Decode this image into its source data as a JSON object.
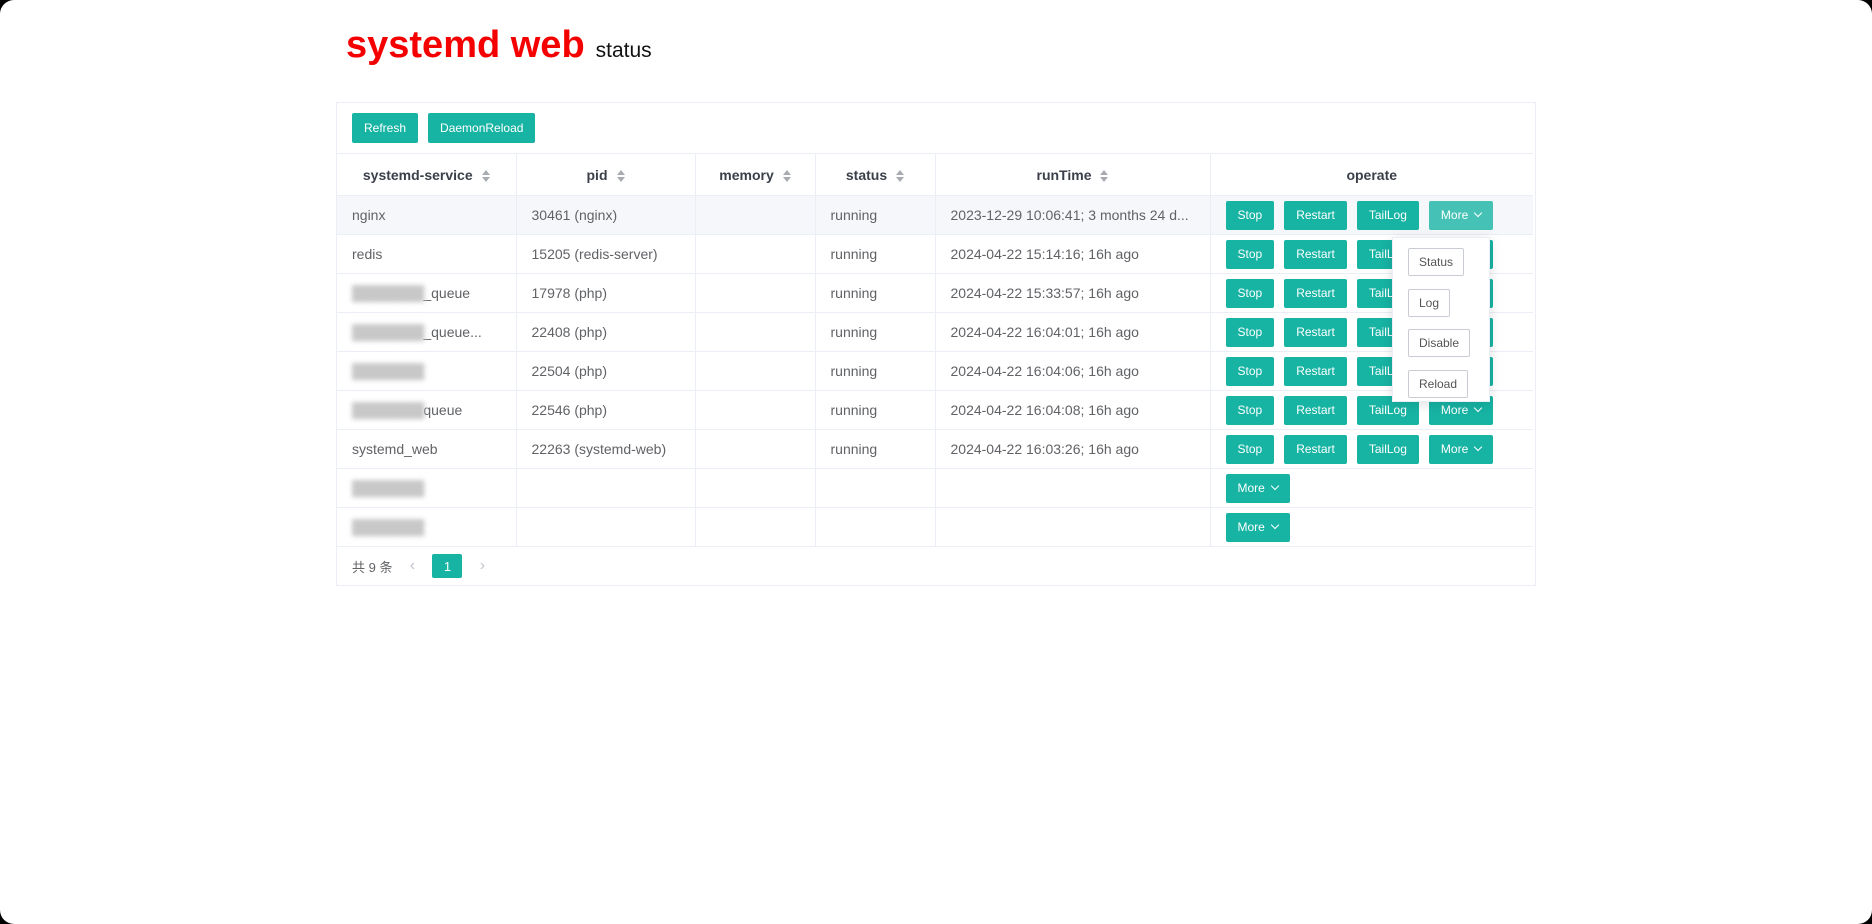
{
  "header": {
    "title": "systemd web",
    "subtitle": "status"
  },
  "toolbar": {
    "refresh": "Refresh",
    "daemon_reload": "DaemonReload"
  },
  "columns": [
    "systemd-service",
    "pid",
    "memory",
    "status",
    "runTime",
    "operate"
  ],
  "actions": {
    "stop": "Stop",
    "restart": "Restart",
    "taillog": "TailLog",
    "more": "More"
  },
  "rows": [
    {
      "service": "nginx",
      "pid": "30461 (nginx)",
      "memory": "",
      "status": "running",
      "runtime": "2023-12-29 10:06:41; 3 months 24 d...",
      "blurred": false,
      "full_ops": true
    },
    {
      "service": "redis",
      "pid": "15205 (redis-server)",
      "memory": "",
      "status": "running",
      "runtime": "2024-04-22 15:14:16; 16h ago",
      "blurred": false,
      "full_ops": true
    },
    {
      "service": "_queue",
      "pid": "17978 (php)",
      "memory": "",
      "status": "running",
      "runtime": "2024-04-22 15:33:57; 16h ago",
      "blurred": true,
      "full_ops": true
    },
    {
      "service": "_queue...",
      "pid": "22408 (php)",
      "memory": "",
      "status": "running",
      "runtime": "2024-04-22 16:04:01; 16h ago",
      "blurred": true,
      "full_ops": true
    },
    {
      "service": "",
      "pid": "22504 (php)",
      "memory": "",
      "status": "running",
      "runtime": "2024-04-22 16:04:06; 16h ago",
      "blurred": true,
      "full_ops": true
    },
    {
      "service": "queue",
      "pid": "22546 (php)",
      "memory": "",
      "status": "running",
      "runtime": "2024-04-22 16:04:08; 16h ago",
      "blurred": true,
      "full_ops": true
    },
    {
      "service": "systemd_web",
      "pid": "22263 (systemd-web)",
      "memory": "",
      "status": "running",
      "runtime": "2024-04-22 16:03:26; 16h ago",
      "blurred": false,
      "full_ops": true
    },
    {
      "service": "",
      "pid": "",
      "memory": "",
      "status": "",
      "runtime": "",
      "blurred": true,
      "full_ops": false
    },
    {
      "service": "",
      "pid": "",
      "memory": "",
      "status": "",
      "runtime": "",
      "blurred": true,
      "full_ops": false
    }
  ],
  "dropdown": {
    "items": [
      "Status",
      "Log",
      "Disable",
      "Reload"
    ]
  },
  "pagination": {
    "total": "共 9 条",
    "current_page": "1"
  },
  "colors": {
    "accent": "#17b3a3",
    "title": "#f50000"
  }
}
